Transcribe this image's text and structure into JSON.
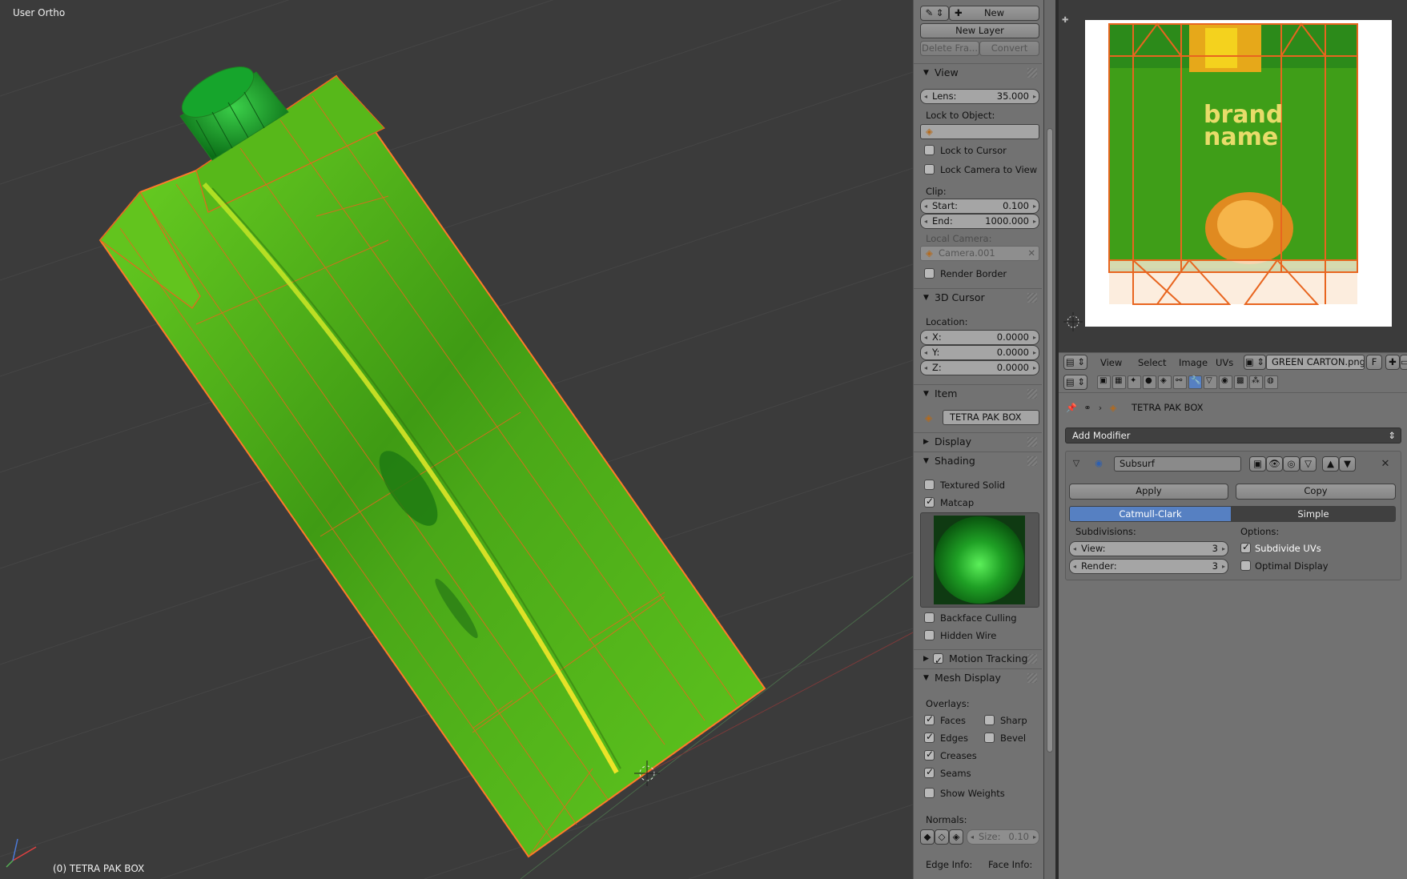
{
  "viewport": {
    "title": "User Ortho",
    "object_label": "(0) TETRA PAK BOX"
  },
  "npanel": {
    "grease_pencil": {
      "new_label": "New",
      "new_layer_label": "New Layer",
      "delete_frame_label": "Delete Fra...",
      "convert_label": "Convert"
    },
    "view": {
      "header": "View",
      "lens_label": "Lens:",
      "lens_value": "35.000",
      "lock_to_object_label": "Lock to Object:",
      "lock_to_cursor_label": "Lock to Cursor",
      "lock_camera_label": "Lock Camera to View",
      "clip_label": "Clip:",
      "clip_start_label": "Start:",
      "clip_start_value": "0.100",
      "clip_end_label": "End:",
      "clip_end_value": "1000.000",
      "local_camera_label": "Local Camera:",
      "local_camera_value": "Camera.001",
      "render_border_label": "Render Border"
    },
    "cursor": {
      "header": "3D Cursor",
      "location_label": "Location:",
      "x_label": "X:",
      "x_value": "0.0000",
      "y_label": "Y:",
      "y_value": "0.0000",
      "z_label": "Z:",
      "z_value": "0.0000"
    },
    "item": {
      "header": "Item",
      "name": "TETRA PAK BOX"
    },
    "display": {
      "header": "Display"
    },
    "shading": {
      "header": "Shading",
      "textured_solid_label": "Textured Solid",
      "matcap_label": "Matcap",
      "backface_culling_label": "Backface Culling",
      "hidden_wire_label": "Hidden Wire"
    },
    "motion_tracking": {
      "header": "Motion Tracking"
    },
    "mesh_display": {
      "header": "Mesh Display",
      "overlays_label": "Overlays:",
      "faces_label": "Faces",
      "sharp_label": "Sharp",
      "edges_label": "Edges",
      "bevel_label": "Bevel",
      "creases_label": "Creases",
      "seams_label": "Seams",
      "show_weights_label": "Show Weights",
      "normals_label": "Normals:",
      "size_label": "Size:",
      "size_value": "0.10",
      "edge_info_label": "Edge Info:",
      "face_info_label": "Face Info:"
    }
  },
  "image_editor": {
    "menu": [
      "View",
      "Select",
      "Image",
      "UVs"
    ],
    "image_name": "GREEN CARTON.png",
    "fake_user_label": "F",
    "texture_text_line1": "brand",
    "texture_text_line2": "name"
  },
  "properties": {
    "breadcrumb_object": "TETRA PAK BOX",
    "add_modifier_label": "Add Modifier",
    "modifier_name": "Subsurf",
    "apply_label": "Apply",
    "copy_label": "Copy",
    "catmull_label": "Catmull-Clark",
    "simple_label": "Simple",
    "subdivisions_label": "Subdivisions:",
    "view_label": "View:",
    "view_value": "3",
    "render_label": "Render:",
    "render_value": "3",
    "options_label": "Options:",
    "subdivide_uvs_label": "Subdivide UVs",
    "optimal_display_label": "Optimal Display"
  },
  "colors": {
    "active_blue": "#5680c2",
    "mesh_green": "#4fc21a",
    "edge_orange": "#e8651f"
  }
}
